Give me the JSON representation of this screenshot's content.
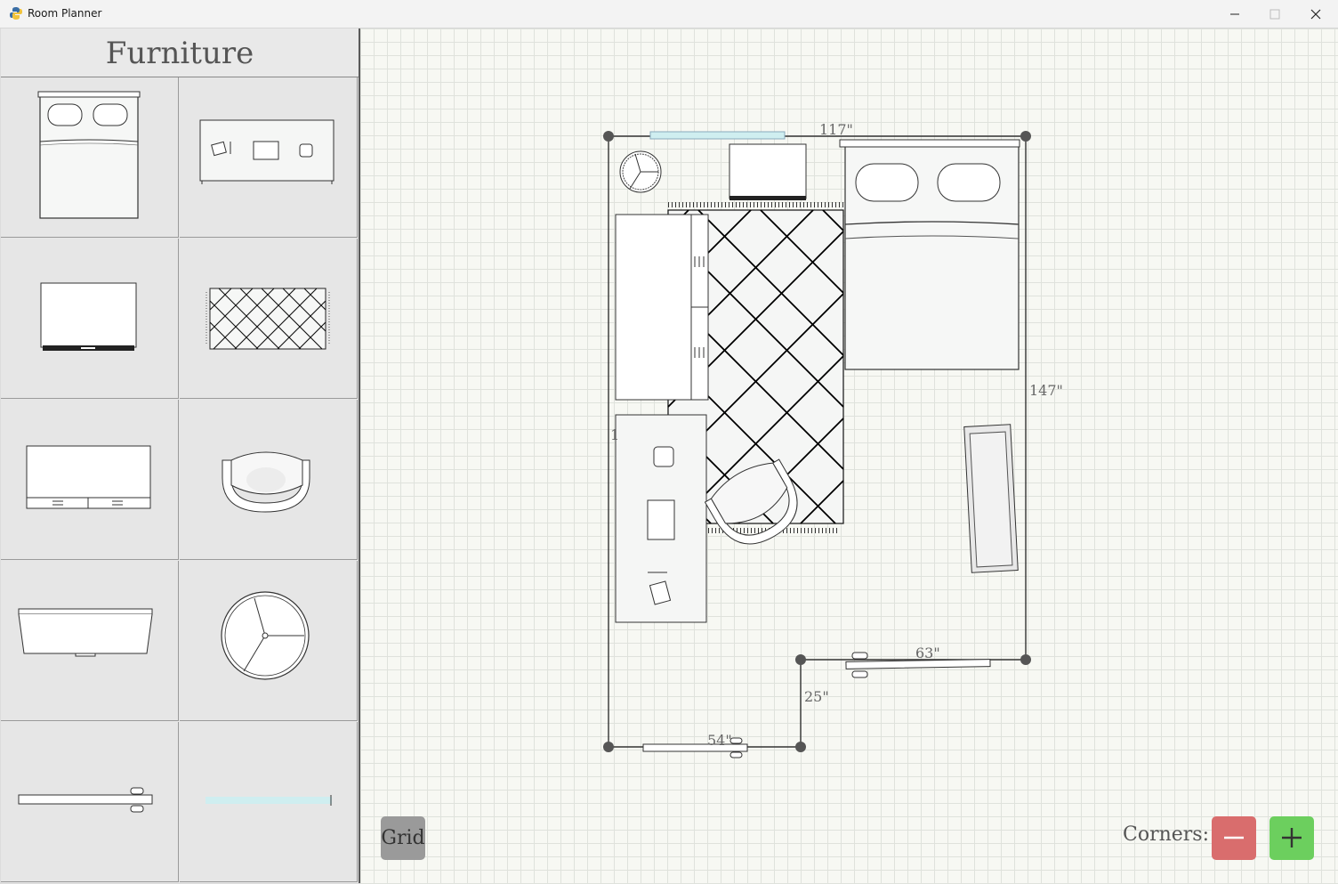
{
  "window": {
    "title": "Room Planner",
    "icon": "python-icon"
  },
  "sidebar": {
    "title": "Furniture",
    "items": [
      {
        "icon": "bed-icon"
      },
      {
        "icon": "desk-icon"
      },
      {
        "icon": "tv-stand-icon"
      },
      {
        "icon": "rug-icon"
      },
      {
        "icon": "dresser-icon"
      },
      {
        "icon": "armchair-icon"
      },
      {
        "icon": "bench-icon"
      },
      {
        "icon": "round-table-icon"
      },
      {
        "icon": "door-icon"
      },
      {
        "icon": "window-icon"
      }
    ]
  },
  "canvas": {
    "dimensions": {
      "top": "117\"",
      "right": "147\"",
      "notch_top": "63\"",
      "notch_side": "25\"",
      "bottom": "54\"",
      "partial": "1"
    }
  },
  "controls": {
    "grid_label": "Grid",
    "corners_label": "Corners:",
    "remove_corner_color": "#d96d6d",
    "add_corner_color": "#6ccf5e"
  }
}
